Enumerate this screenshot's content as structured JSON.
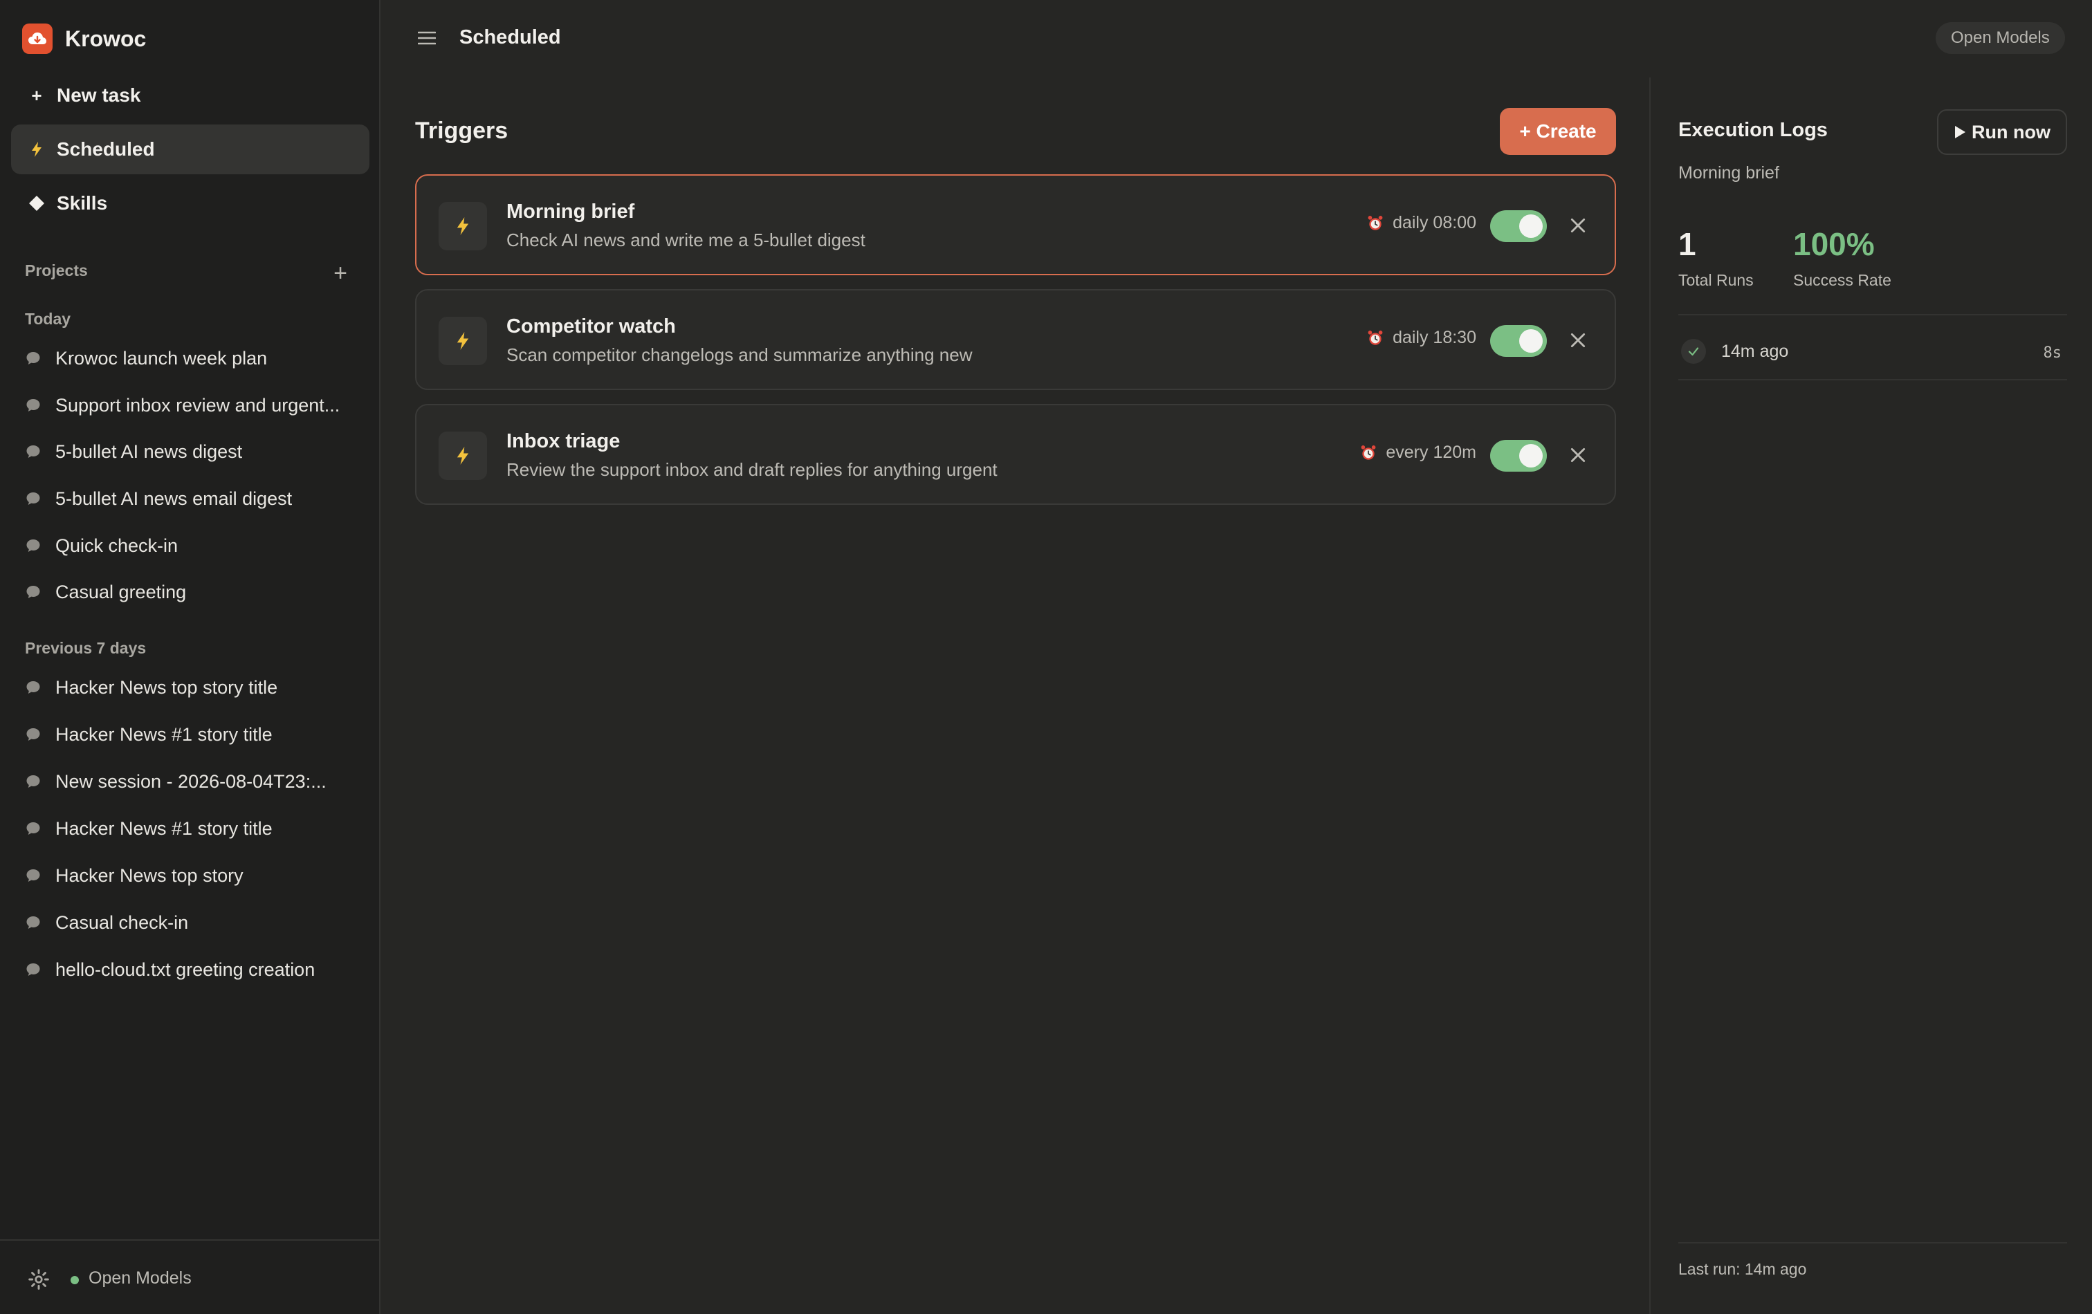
{
  "app": {
    "name": "Krowoc"
  },
  "sidebar": {
    "nav": [
      {
        "label": "New task",
        "icon": "plus-icon"
      },
      {
        "label": "Scheduled",
        "icon": "lightning-icon"
      },
      {
        "label": "Skills",
        "icon": "diamond-icon"
      }
    ],
    "projects_label": "Projects",
    "today_label": "Today",
    "today": [
      "Krowoc launch week plan",
      "Support inbox review and urgent...",
      "5-bullet AI news digest",
      "5-bullet AI news email digest",
      "Quick check-in",
      "Casual greeting"
    ],
    "previous_label": "Previous 7 days",
    "previous": [
      "Hacker News top story title",
      "Hacker News #1 story title",
      "New session - 2026-08-04T23:...",
      "Hacker News #1 story title",
      "Hacker News top story",
      "Casual check-in",
      "hello-cloud.txt greeting creation"
    ],
    "footer_label": "Open Models"
  },
  "header": {
    "title": "Scheduled",
    "pill": "Open Models"
  },
  "triggers": {
    "title": "Triggers",
    "create_label": "+ Create",
    "items": [
      {
        "name": "Morning brief",
        "desc": "Check AI news and write me a 5-bullet digest",
        "schedule": "daily 08:00",
        "enabled": true,
        "selected": true
      },
      {
        "name": "Competitor watch",
        "desc": "Scan competitor changelogs and summarize anything new",
        "schedule": "daily 18:30",
        "enabled": true,
        "selected": false
      },
      {
        "name": "Inbox triage",
        "desc": "Review the support inbox and draft replies for anything urgent",
        "schedule": "every 120m",
        "enabled": true,
        "selected": false
      }
    ]
  },
  "logs": {
    "title": "Execution Logs",
    "run_label": "Run now",
    "subtitle": "Morning brief",
    "total_runs": "1",
    "total_runs_label": "Total Runs",
    "success_rate": "100%",
    "success_rate_label": "Success Rate",
    "entries": [
      {
        "time": "14m ago",
        "duration": "8s",
        "status": "success"
      }
    ],
    "last_run": "Last run: 14m ago"
  },
  "colors": {
    "accent": "#d86d4e",
    "toggle_on": "#7bbf84",
    "success": "#7bbf84",
    "brand": "#e2512f"
  }
}
